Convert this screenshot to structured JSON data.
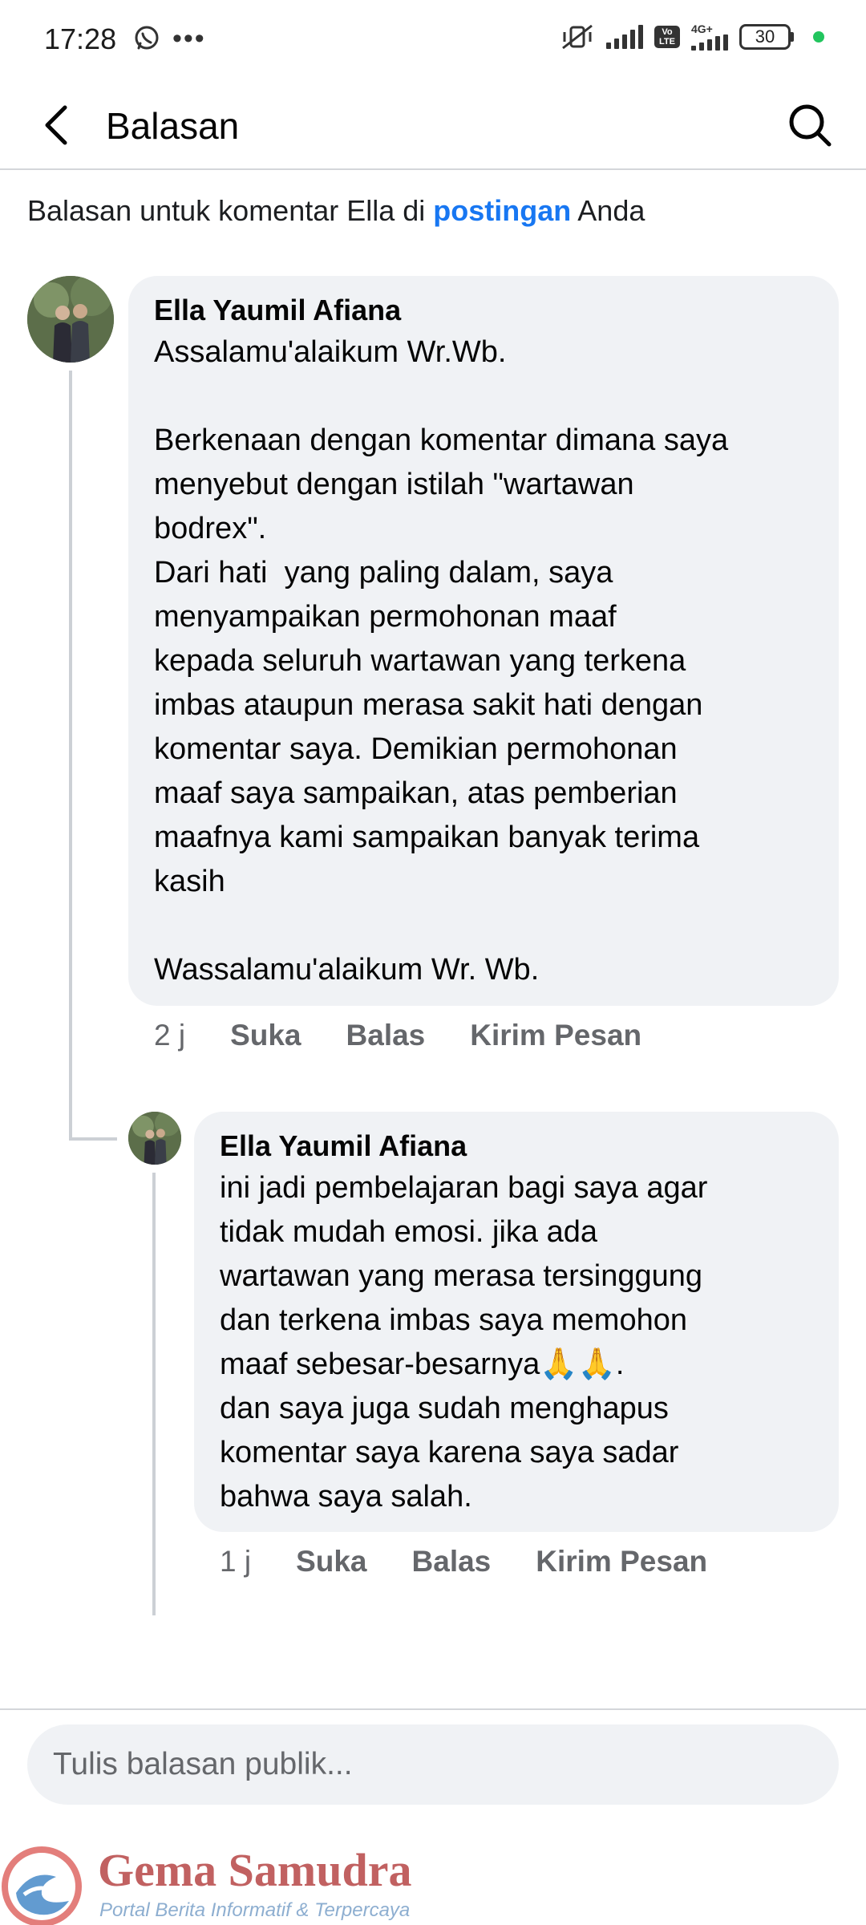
{
  "status_bar": {
    "time": "17:28",
    "battery": "30",
    "net_label": "4G+",
    "volte_label": "Vo LTE"
  },
  "header": {
    "title": "Balasan"
  },
  "context": {
    "prefix": "Balasan untuk komentar Ella di ",
    "link": "postingan",
    "suffix": " Anda"
  },
  "comments": [
    {
      "author": "Ella Yaumil Afiana",
      "text": "Assalamu'alaikum Wr.Wb.\n\nBerkenaan dengan komentar dimana saya\nmenyebut dengan istilah \"wartawan\nbodrex\".\nDari hati  yang paling dalam, saya\nmenyampaikan permohonan maaf\nkepada seluruh wartawan yang terkena\nimbas ataupun merasa sakit hati dengan\nkomentar saya. Demikian permohonan\nmaaf saya sampaikan, atas pemberian\nmaafnya kami sampaikan banyak terima\nkasih\n\nWassalamu'alaikum Wr. Wb.",
      "time": "2 j",
      "like": "Suka",
      "reply": "Balas",
      "message": "Kirim Pesan"
    },
    {
      "author": "Ella Yaumil Afiana",
      "text": "ini jadi pembelajaran bagi saya agar\ntidak mudah emosi. jika ada\nwartawan yang merasa tersinggung\ndan terkena imbas saya memohon\nmaaf sebesar-besarnya🙏🙏.\ndan saya juga sudah menghapus\nkomentar saya karena saya sadar\nbahwa saya salah.",
      "time": "1 j",
      "like": "Suka",
      "reply": "Balas",
      "message": "Kirim Pesan"
    }
  ],
  "composer": {
    "placeholder": "Tulis balasan publik..."
  },
  "watermark": {
    "name": "Gema Samudra",
    "tagline": "Portal Berita Informatif & Terpercaya"
  },
  "colors": {
    "link": "#1877f2",
    "bubble": "#f0f2f5",
    "meta": "#65676b",
    "status_dot": "#22c55e"
  }
}
